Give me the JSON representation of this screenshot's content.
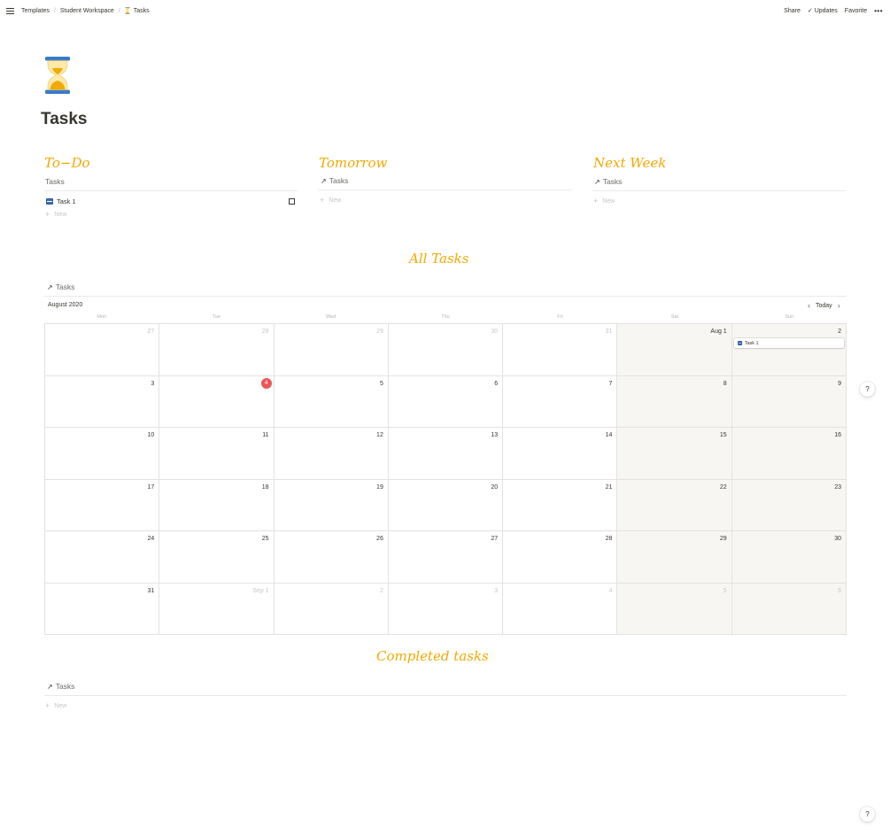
{
  "topbar": {
    "breadcrumbs": [
      "Templates",
      "Student Workspace",
      "Tasks"
    ],
    "separator": "/",
    "actions": {
      "share": "Share",
      "updates": "Updates",
      "favorite": "Favorite",
      "more": "•••"
    },
    "check_glyph": "✓"
  },
  "page": {
    "title": "Tasks",
    "icon": "hourglass-icon"
  },
  "columns": [
    {
      "heading": "To−Do",
      "view_title": "Tasks",
      "tasks": [
        "Task 1"
      ],
      "new_label": "New"
    },
    {
      "heading": "Tomorrow",
      "view_title": "Tasks",
      "tasks": [],
      "new_label": "New"
    },
    {
      "heading": "Next Week",
      "view_title": "Tasks",
      "tasks": [],
      "new_label": "New"
    }
  ],
  "all_tasks": {
    "heading": "All Tasks",
    "view_title": "Tasks",
    "month": "August 2020",
    "today_label": "Today",
    "weekdays": [
      "Mon",
      "Tue",
      "Wed",
      "Thu",
      "Fri",
      "Sat",
      "Sun"
    ],
    "weeks": [
      [
        "27",
        "28",
        "29",
        "30",
        "31",
        "Aug 1",
        "2"
      ],
      [
        "3",
        "4",
        "5",
        "6",
        "7",
        "8",
        "9"
      ],
      [
        "10",
        "11",
        "12",
        "13",
        "14",
        "15",
        "16"
      ],
      [
        "17",
        "18",
        "19",
        "20",
        "21",
        "22",
        "23"
      ],
      [
        "24",
        "25",
        "26",
        "27",
        "28",
        "29",
        "30"
      ],
      [
        "31",
        "Sep 1",
        "2",
        "3",
        "4",
        "5",
        "6"
      ]
    ],
    "event": {
      "label": "Task 1"
    }
  },
  "completed": {
    "heading": "Completed tasks",
    "view_title": "Tasks",
    "new_label": "New"
  },
  "help_label": "?",
  "colors": {
    "accent_heading": "#f2a900",
    "today_badge": "#eb5757",
    "weekend_bg": "#f7f6f3"
  }
}
